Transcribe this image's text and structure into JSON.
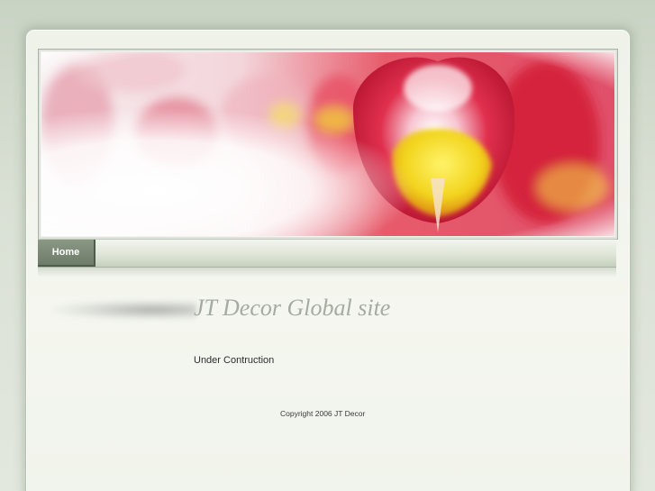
{
  "nav": {
    "items": [
      {
        "label": "Home"
      }
    ]
  },
  "banner": {
    "image": "tulip-photo"
  },
  "main": {
    "title": "JT Decor Global site",
    "status_text": "Under Contruction"
  },
  "footer": {
    "copyright": "Copyright 2006 JT Decor"
  },
  "colors": {
    "background": "#d9e0d4",
    "nav_active": "#6d7c69",
    "title_text": "#a5aba1",
    "tulip_red": "#d8223f",
    "tulip_yellow": "#f0d81a"
  }
}
